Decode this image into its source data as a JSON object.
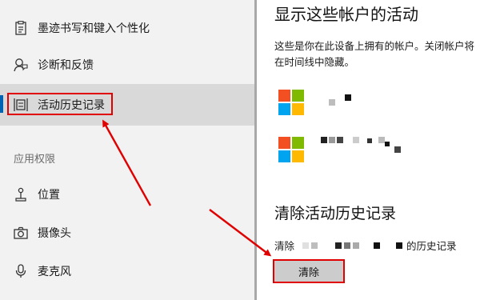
{
  "sidebar": {
    "items": [
      {
        "label": "墨迹书写和键入个性化",
        "icon": "clipboard-icon"
      },
      {
        "label": "诊断和反馈",
        "icon": "diagnostics-icon"
      },
      {
        "label": "活动历史记录",
        "icon": "activity-history-icon",
        "selected": true
      }
    ],
    "section_label": "应用权限",
    "permission_items": [
      {
        "label": "位置",
        "icon": "location-icon"
      },
      {
        "label": "摄像头",
        "icon": "camera-icon"
      },
      {
        "label": "麦克风",
        "icon": "microphone-icon"
      }
    ]
  },
  "main": {
    "heading": "显示这些帐户的活动",
    "description": "这些是你在此设备上拥有的帐户。关闭帐户将在时间线中隐藏。",
    "accounts_count": 2,
    "clear_heading": "清除活动历史记录",
    "clear_prefix": "清除",
    "clear_suffix": "的历史记录",
    "clear_button": "清除"
  },
  "colors": {
    "accent": "#0063b1",
    "annotation_red": "#e00000",
    "ms_red": "#f25022",
    "ms_green": "#7fba00",
    "ms_blue": "#00a4ef",
    "ms_yellow": "#ffb900"
  }
}
